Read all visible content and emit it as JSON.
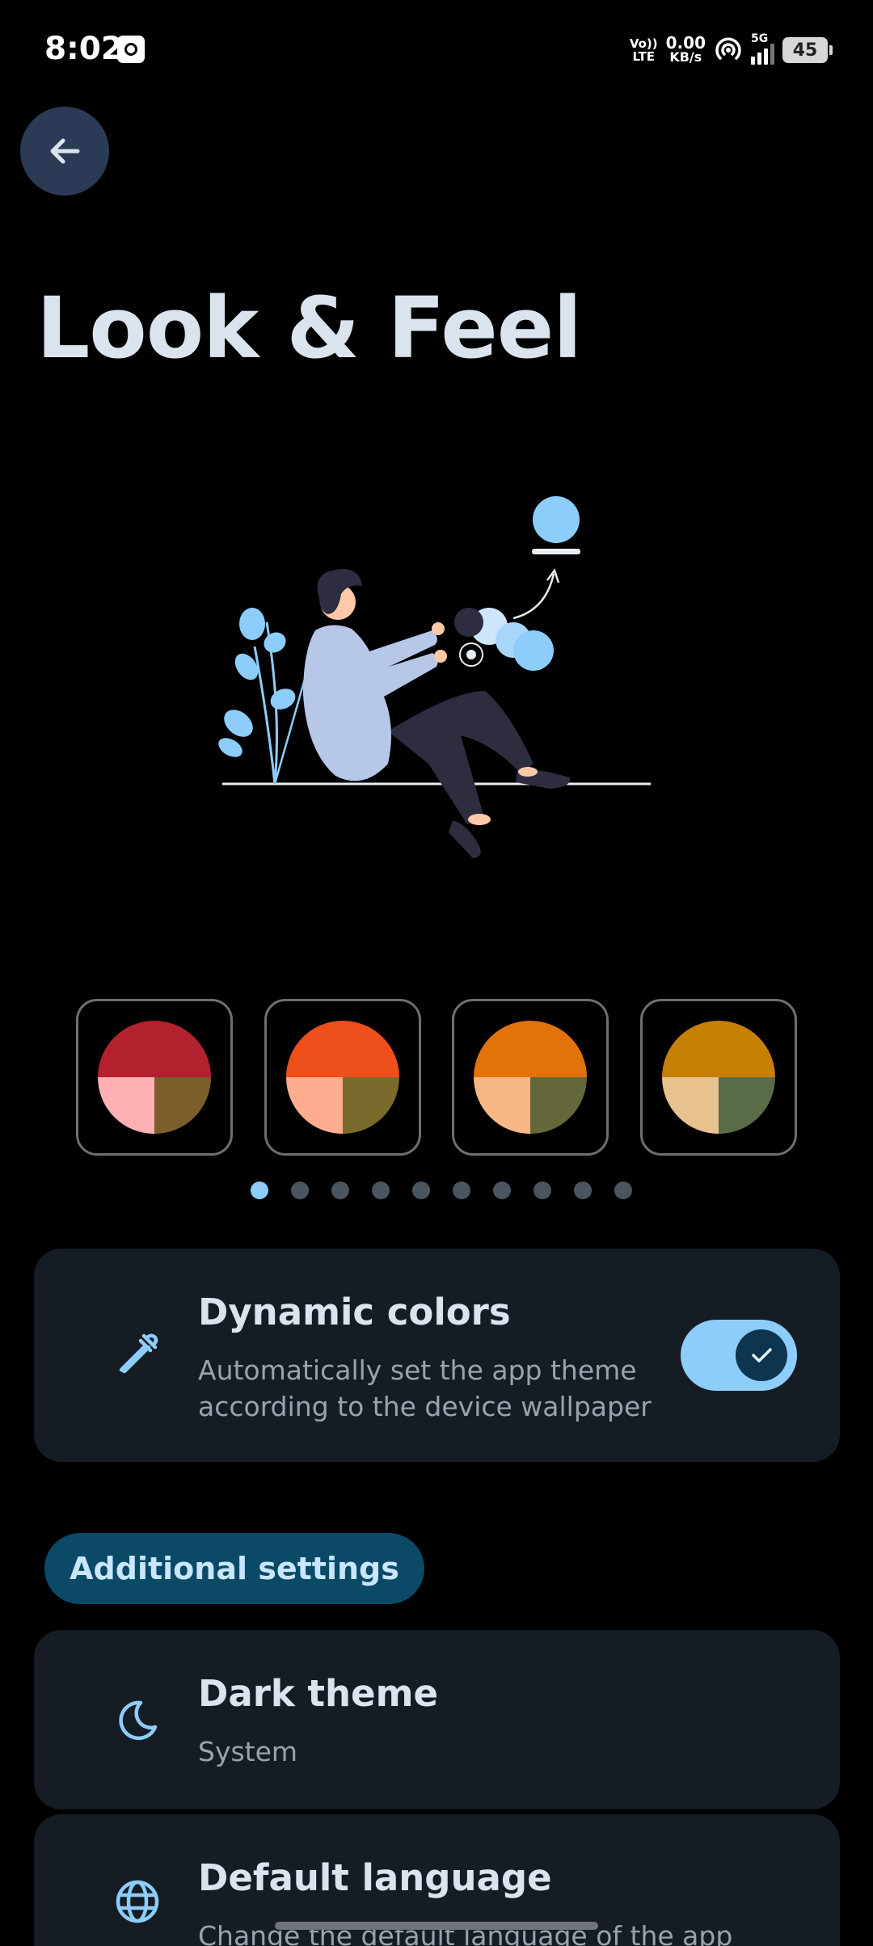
{
  "status_bar": {
    "time": "8:02",
    "volte_top": "Vo))",
    "volte_bottom": "LTE",
    "net_speed_value": "0.00",
    "net_speed_unit": "KB/s",
    "network_type": "5G",
    "battery": "45"
  },
  "header": {
    "back_icon": "arrow-left-icon",
    "title": "Look & Feel"
  },
  "palettes": [
    {
      "top": "#b3202e",
      "bottom_left": "#ffb0b4",
      "bottom_right": "#7a5f2c"
    },
    {
      "top": "#ee4f1b",
      "bottom_left": "#ffad8f",
      "bottom_right": "#7a6a2c"
    },
    {
      "top": "#e2720a",
      "bottom_left": "#f7b784",
      "bottom_right": "#63673a"
    },
    {
      "top": "#c68005",
      "bottom_left": "#e7c28e",
      "bottom_right": "#5a6b48"
    }
  ],
  "page_indicator": {
    "count": 10,
    "active": 0
  },
  "dynamic_colors": {
    "icon": "eyedropper-icon",
    "title": "Dynamic colors",
    "subtitle_line1": "Automatically set the app theme",
    "subtitle_line2": "according to the device wallpaper",
    "enabled": true
  },
  "additional_settings_label": "Additional settings",
  "dark_theme": {
    "icon": "moon-icon",
    "title": "Dark theme",
    "value": "System"
  },
  "default_language": {
    "icon": "globe-icon",
    "title": "Default language",
    "subtitle": "Change the default language of the app"
  },
  "colors": {
    "accent": "#8dcdfb",
    "card_bg": "#161c23",
    "chip_bg": "#0b4a67"
  }
}
